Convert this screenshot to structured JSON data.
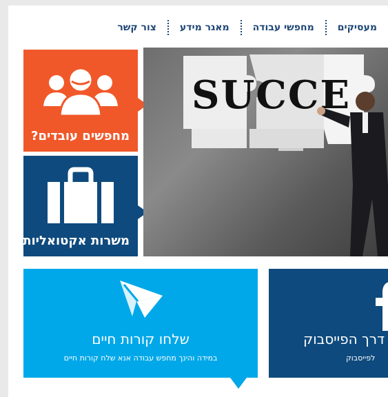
{
  "nav": {
    "items": [
      "מעסיקים",
      "מחפשי עבודה",
      "מאגר מידע",
      "צור קשר"
    ]
  },
  "tiles": {
    "job_seekers": {
      "label": "מחפשים עובדים?",
      "icon": "people-icon",
      "color": "#f0582a"
    },
    "jobs": {
      "label": "משרות אקטואליות",
      "icon": "briefcase-icon",
      "color": "#0e4a7d"
    }
  },
  "hero": {
    "word": "SUCCE"
  },
  "cv_block": {
    "title": "שלחו קורות חיים",
    "subtitle": "במידה והינך מחפש עבודה אנא שלח קורות חיים",
    "icon": "paper-plane-icon",
    "color": "#00a8e9"
  },
  "fb_block": {
    "title": "דרך הפייסבוק",
    "subtitle": "לפייסבוק",
    "icon": "facebook-icon",
    "color": "#0e4a7d"
  }
}
